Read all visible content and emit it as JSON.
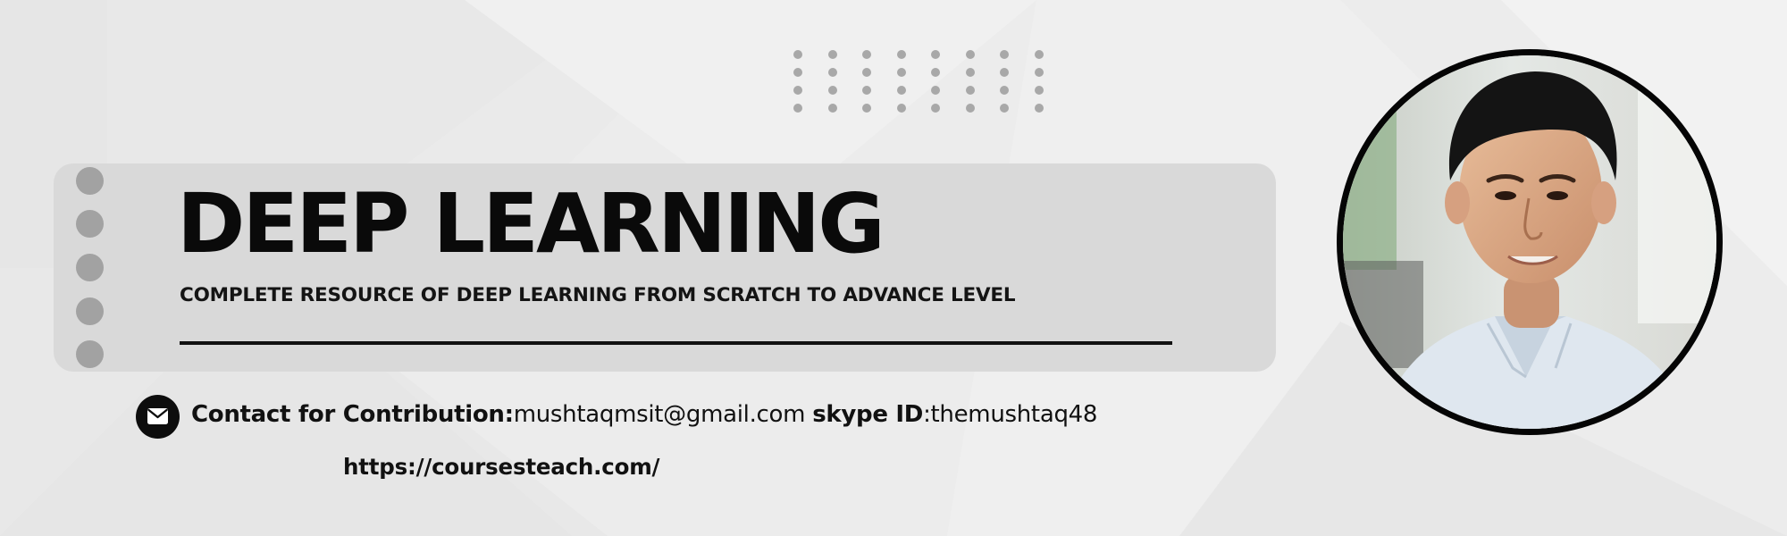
{
  "banner": {
    "title": "DEEP LEARNING",
    "subtitle": "COMPLETE RESOURCE OF DEEP LEARNING FROM SCRATCH TO ADVANCE LEVEL",
    "contact": {
      "label": "Contact for Contribution:",
      "email": "mushtaqmsit@gmail.com",
      "skype_label": "skype ID",
      "skype_separator": ":",
      "skype_id": "themushtaq48"
    },
    "website": "https://coursesteach.com/",
    "icons": {
      "contact": "envelope-icon",
      "portrait": "portrait-photo"
    },
    "colors": {
      "background": "#ececec",
      "panel": "#d9d9d9",
      "text": "#0a0a0a",
      "dots": "#a8a8a8"
    }
  }
}
